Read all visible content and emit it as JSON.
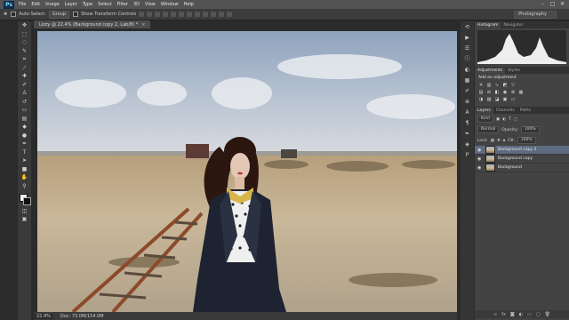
{
  "menubar": {
    "app_logo": "Ps",
    "items": [
      "File",
      "Edit",
      "Image",
      "Layer",
      "Type",
      "Select",
      "Filter",
      "3D",
      "View",
      "Window",
      "Help"
    ],
    "window_buttons": [
      "–",
      "□",
      "✕"
    ]
  },
  "options": {
    "auto_select_label": "Auto-Select:",
    "auto_select_value": "Group",
    "show_transform_label": "Show Transform Controls",
    "workspace": "Photography"
  },
  "document": {
    "tab_title": "Lizzy @ 22.4% (Background copy 2, Lab/8) *",
    "close_glyph": "×"
  },
  "status": {
    "zoom": "22.4%",
    "doc_size": "Doc: 73.0M/154.0M"
  },
  "panels": {
    "histogram_tabs": [
      "Histogram",
      "Navigator"
    ],
    "adjustment_tabs": [
      "Adjustments",
      "Styles"
    ],
    "adjustment_title": "Add an adjustment",
    "layer_tabs": [
      "Layers",
      "Channels",
      "Paths"
    ],
    "layer_kind": "Kind",
    "blend_mode": "Normal",
    "opacity_label": "Opacity:",
    "opacity_value": "100%",
    "lock_label": "Lock:",
    "fill_label": "Fill:",
    "fill_value": "100%",
    "layers": [
      {
        "name": "Background copy 2",
        "selected": true
      },
      {
        "name": "Background copy",
        "selected": false
      },
      {
        "name": "Background",
        "selected": false
      }
    ]
  }
}
